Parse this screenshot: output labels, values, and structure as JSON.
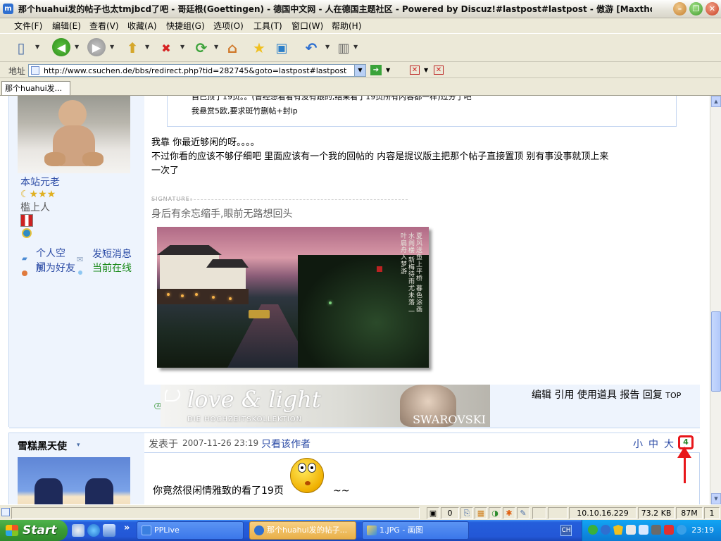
{
  "window": {
    "title": "那个huahui发的帖子也太tmjbcd了吧 - 哥廷根(Goettingen) - 德国中文网 - 人在德国主题社区 - Powered by Discuz!#lastpost#lastpost - 傲游 [Maxthon]",
    "app_icon": "maxthon-icon",
    "minimize_label": "–",
    "restore_label": "❐",
    "close_label": "✕"
  },
  "menu": [
    {
      "label": "文件(F)"
    },
    {
      "label": "编辑(E)"
    },
    {
      "label": "查看(V)"
    },
    {
      "label": "收藏(A)"
    },
    {
      "label": "快捷组(G)"
    },
    {
      "label": "选项(O)"
    },
    {
      "label": "工具(T)"
    },
    {
      "label": "窗口(W)"
    },
    {
      "label": "帮助(H)"
    }
  ],
  "toolbar": {
    "icons": [
      "new-page-icon",
      "back-icon",
      "forward-icon",
      "up-icon",
      "stop-icon",
      "refresh-icon",
      "home-icon",
      "favorites-icon",
      "window-icon",
      "undo-icon",
      "tools-icon"
    ]
  },
  "address": {
    "label": "地址",
    "url": "http://www.csuchen.de/bbs/redirect.php?tid=282745&goto=lastpost#lastpost"
  },
  "tabs": [
    {
      "label": "那个huahui发..."
    }
  ],
  "post1": {
    "author_title": "本站元老",
    "rank_label": "槛上人",
    "links": {
      "space": "个人空间",
      "add_friend": "加为好友",
      "pm": "发短消息",
      "online": "当前在线"
    },
    "quote_line1": "自己顶了19页。。(曾经想看看有没有跟的,结果看了19页所有内容都一样)过分了吧",
    "quote_line2": "我悬赏5欧,要求斑竹删帖+封ip",
    "reply_line1": "我靠  你最近够闲的呀。。。。",
    "reply_line2": "不过你看的应该不够仔细吧  里面应该有一个我的回帖的  内容是提议版主把那个帖子直接置顶 别有事没事就顶上来",
    "reply_line3": "一次了",
    "signature_label": "SIGNATURE:",
    "signature_text": "身后有余忘缩手,眼前无路想回头",
    "poem_text": "夏风送鱼上平桥 暮色涂画水阁楼 新梅待雨尤未落 一叶扁舟入梦游",
    "ad_badge": "AD",
    "ad_title": "love & light",
    "ad_subtitle": "DIE HOCHZEITSKOLLEKTION",
    "ad_brand": "SWAROVSKI",
    "actions": [
      "编辑",
      "引用",
      "使用道具",
      "报告",
      "回复",
      "TOP"
    ]
  },
  "post2": {
    "author": "雪糕黑天使",
    "posted_prefix": "发表于",
    "posted_time": "2007-11-26 23:19",
    "only_author": "只看该作者",
    "size_small": "小",
    "size_medium": "中",
    "size_large": "大",
    "floor_number": "4",
    "text": "你竟然很闲情雅致的看了19页",
    "tail": "~~"
  },
  "status": {
    "zero": "0",
    "ip": "10.10.16.229",
    "size": "73.2 KB",
    "mem": "87M",
    "count": "1"
  },
  "taskbar": {
    "start": "Start",
    "more": "»",
    "buttons": [
      {
        "label": "PPLive"
      },
      {
        "label": "那个huahui发的帖子..."
      },
      {
        "label": "1.JPG - 画图"
      }
    ],
    "lang": "CH",
    "clock": "23:19"
  },
  "colors": {
    "link": "#2a4aa5",
    "annotation": "#e8161a",
    "online": "#1a8a1a"
  }
}
